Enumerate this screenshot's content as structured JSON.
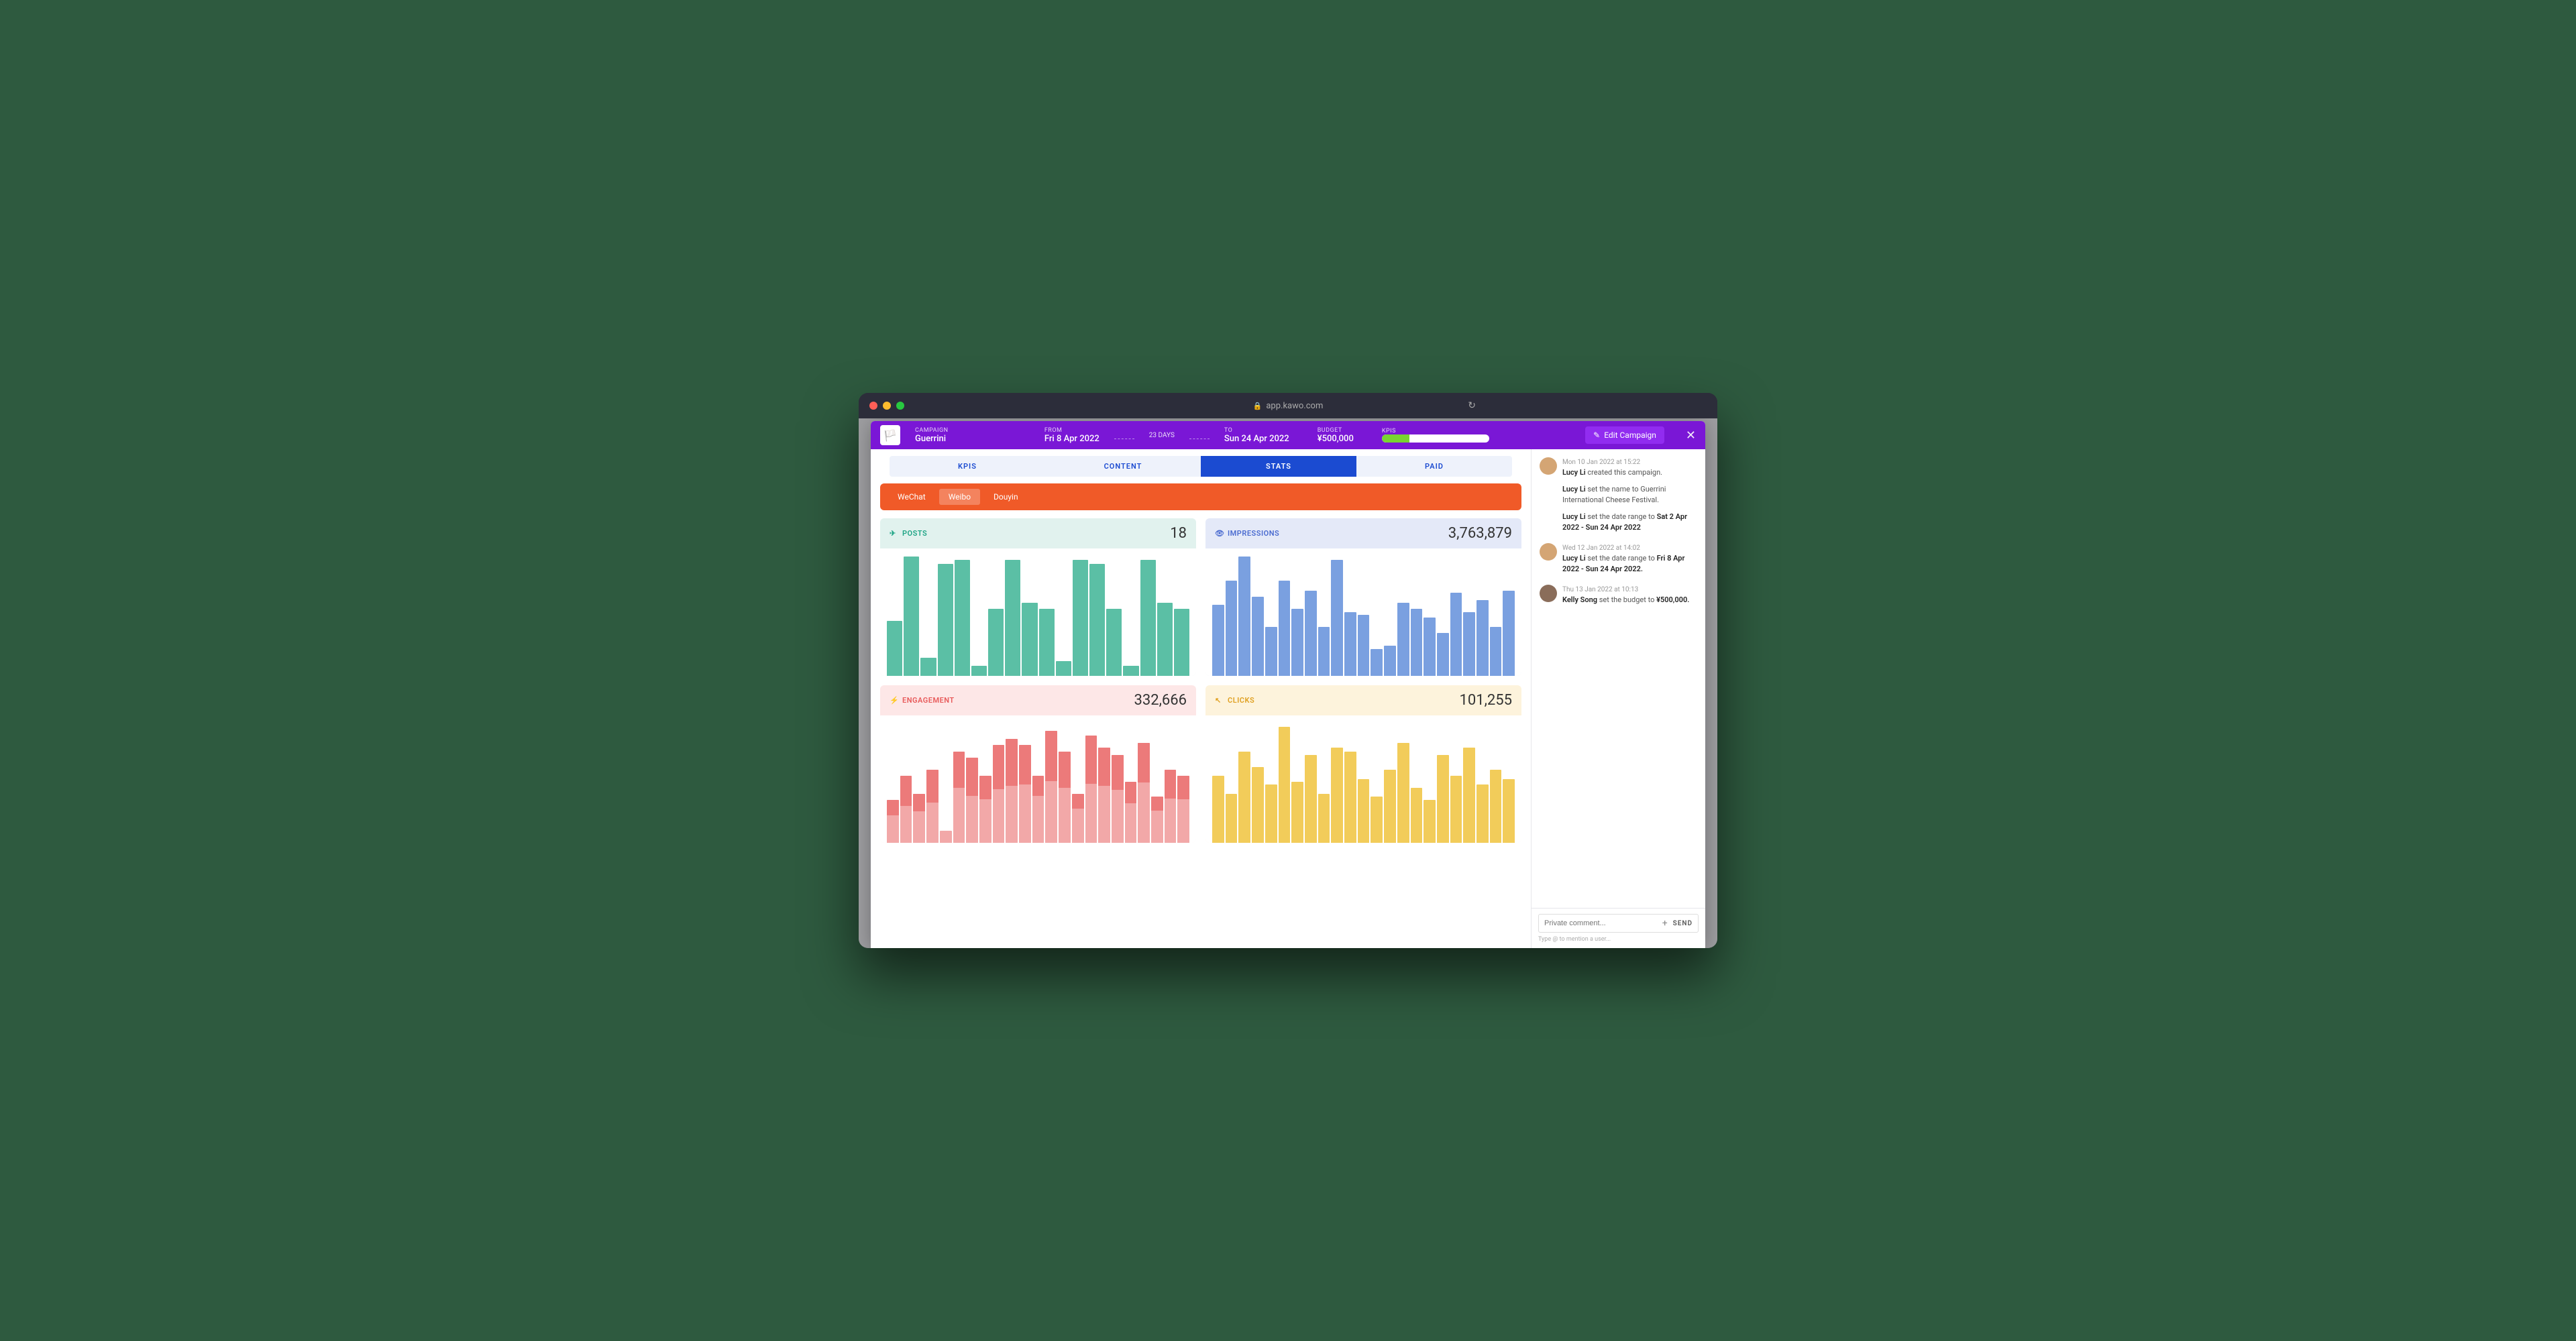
{
  "browser": {
    "url": "app.kawo.com"
  },
  "header": {
    "campaign_label": "CAMPAIGN",
    "campaign_name": "Guerrini",
    "from_label": "FROM",
    "from_value": "Fri 8 Apr 2022",
    "duration": "23 DAYS",
    "to_label": "TO",
    "to_value": "Sun 24 Apr 2022",
    "budget_label": "BUDGET",
    "budget_value": "¥500,000",
    "kpis_label": "KPIS",
    "edit_label": "Edit Campaign"
  },
  "tabs": {
    "kpis": "KPIS",
    "content": "CONTENT",
    "stats": "STATS",
    "paid": "PAID"
  },
  "channels": {
    "wechat": "WeChat",
    "weibo": "Weibo",
    "douyin": "Douyin"
  },
  "cards": {
    "posts": {
      "label": "POSTS",
      "value": "18"
    },
    "impressions": {
      "label": "IMPRESSIONS",
      "value": "3,763,879"
    },
    "engagement": {
      "label": "ENGAGEMENT",
      "value": "332,666"
    },
    "clicks": {
      "label": "CLICKS",
      "value": "101,255"
    }
  },
  "feed": {
    "e1_ts": "Mon 10 Jan 2022 at 15:22",
    "e1_a": "Lucy Li",
    "e1_b": " created this campaign.",
    "e1_c": "Lucy Li",
    "e1_d": " set the name to Guerrini International Cheese Festival.",
    "e1_e": "Lucy Li",
    "e1_f": " set the date range to ",
    "e1_g": "Sat 2 Apr 2022 - Sun 24 Apr 2022",
    "e2_ts": "Wed 12 Jan 2022 at 14:02",
    "e2_a": "Lucy Li",
    "e2_b": " set the date range to ",
    "e2_c": "Fri 8 Apr 2022 - Sun 24 Apr 2022.",
    "e3_ts": "Thu 13 Jan 2022 at 10:13",
    "e3_a": "Kelly Song",
    "e3_b": " set the budget to ",
    "e3_c": "¥500,000."
  },
  "comment": {
    "placeholder": "Private comment...",
    "send": "SEND",
    "hint": "Type @ to mention a user..."
  },
  "chart_data": [
    {
      "type": "bar",
      "title": "POSTS",
      "total": 18,
      "values": [
        45,
        98,
        15,
        92,
        95,
        8,
        55,
        95,
        60,
        55,
        12,
        95,
        92,
        55,
        8,
        95,
        60,
        55
      ]
    },
    {
      "type": "bar",
      "title": "IMPRESSIONS",
      "total": 3763879,
      "values": [
        58,
        78,
        98,
        65,
        40,
        78,
        55,
        70,
        40,
        95,
        52,
        50,
        22,
        25,
        60,
        55,
        48,
        35,
        68,
        52,
        62,
        40,
        70
      ]
    },
    {
      "type": "bar",
      "title": "ENGAGEMENT",
      "total": 332666,
      "series": [
        {
          "name": "base",
          "values": [
            35,
            55,
            40,
            60,
            10,
            75,
            70,
            55,
            80,
            85,
            80,
            55,
            92,
            75,
            40,
            88,
            78,
            72,
            50,
            82,
            38,
            60,
            55
          ]
        },
        {
          "name": "top_fraction",
          "values": [
            0.35,
            0.45,
            0.35,
            0.45,
            0,
            0.4,
            0.45,
            0.35,
            0.45,
            0.45,
            0.4,
            0.3,
            0.45,
            0.4,
            0.3,
            0.45,
            0.4,
            0.4,
            0.35,
            0.4,
            0.3,
            0.4,
            0.35
          ]
        }
      ]
    },
    {
      "type": "bar",
      "title": "CLICKS",
      "total": 101255,
      "values": [
        55,
        40,
        75,
        62,
        48,
        95,
        50,
        72,
        40,
        78,
        75,
        52,
        38,
        60,
        82,
        45,
        35,
        72,
        55,
        78,
        48,
        60,
        52
      ]
    }
  ]
}
